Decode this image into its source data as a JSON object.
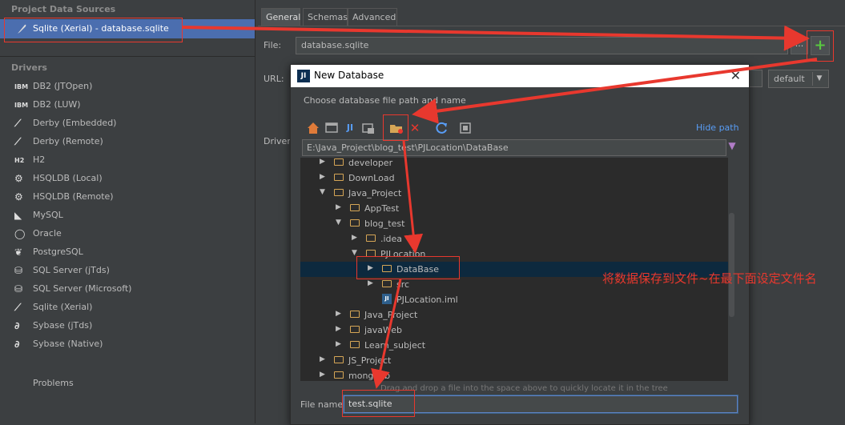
{
  "left": {
    "project_header": "Project Data Sources",
    "selected_source": "Sqlite (Xerial) - database.sqlite",
    "drivers_header": "Drivers",
    "drivers": [
      {
        "icon": "IBM",
        "label": "DB2 (JTOpen)"
      },
      {
        "icon": "IBM",
        "label": "DB2 (LUW)"
      },
      {
        "icon": "feather",
        "label": "Derby (Embedded)"
      },
      {
        "icon": "feather",
        "label": "Derby (Remote)"
      },
      {
        "icon": "H2",
        "label": "H2"
      },
      {
        "icon": "gear",
        "label": "HSQLDB (Local)"
      },
      {
        "icon": "gear",
        "label": "HSQLDB (Remote)"
      },
      {
        "icon": "dolphin",
        "label": "MySQL"
      },
      {
        "icon": "circle",
        "label": "Oracle"
      },
      {
        "icon": "elephant",
        "label": "PostgreSQL"
      },
      {
        "icon": "server",
        "label": "SQL Server (jTds)"
      },
      {
        "icon": "server",
        "label": "SQL Server (Microsoft)"
      },
      {
        "icon": "feather",
        "label": "Sqlite (Xerial)"
      },
      {
        "icon": "swirl",
        "label": "Sybase (jTds)"
      },
      {
        "icon": "swirl",
        "label": "Sybase (Native)"
      }
    ],
    "problems": "Problems"
  },
  "tabs": [
    "General",
    "Schemas",
    "Advanced"
  ],
  "form": {
    "file_label": "File:",
    "file_value": "database.sqlite",
    "browse": "...",
    "add": "+",
    "url_label": "URL:",
    "url_mode": "default",
    "driver_label": "Driver"
  },
  "dialog": {
    "title": "New Database",
    "logo": "JI",
    "close": "✕",
    "subtitle": "Choose database file path and name",
    "hide_path": "Hide path",
    "path": "E:\\Java_Project\\blog_test\\PJLocation\\DataBase",
    "tree": [
      {
        "name": "developer",
        "depth": 0,
        "state": "collapsed",
        "type": "folder"
      },
      {
        "name": "DownLoad",
        "depth": 0,
        "state": "collapsed",
        "type": "folder"
      },
      {
        "name": "Java_Project",
        "depth": 0,
        "state": "expanded",
        "type": "folder"
      },
      {
        "name": "AppTest",
        "depth": 1,
        "state": "collapsed",
        "type": "folder"
      },
      {
        "name": "blog_test",
        "depth": 1,
        "state": "expanded",
        "type": "folder"
      },
      {
        "name": ".idea",
        "depth": 2,
        "state": "collapsed",
        "type": "folder"
      },
      {
        "name": "PJLocation",
        "depth": 2,
        "state": "expanded",
        "type": "folder"
      },
      {
        "name": "DataBase",
        "depth": 3,
        "state": "collapsed",
        "type": "folder",
        "selected": true
      },
      {
        "name": "src",
        "depth": 3,
        "state": "collapsed",
        "type": "folder"
      },
      {
        "name": "PJLocation.iml",
        "depth": 3,
        "state": "leaf",
        "type": "iml"
      },
      {
        "name": "Java_Project",
        "depth": 1,
        "state": "collapsed",
        "type": "folder"
      },
      {
        "name": "javaWeb",
        "depth": 1,
        "state": "collapsed",
        "type": "folder"
      },
      {
        "name": "Learn_subject",
        "depth": 1,
        "state": "collapsed",
        "type": "folder"
      },
      {
        "name": "JS_Project",
        "depth": 0,
        "state": "collapsed",
        "type": "folder"
      },
      {
        "name": "mongodb",
        "depth": 0,
        "state": "collapsed",
        "type": "folder"
      }
    ],
    "dnd_hint": "Drag and drop a file into the space above to quickly locate it in the tree",
    "filename_label": "File name:",
    "filename_value": "test.sqlite"
  },
  "annotation": {
    "text": "将数据保存到文件~在最下面设定文件名",
    "color": "#e8382e"
  },
  "colors": {
    "selection": "#4b6eaf",
    "tree_selection": "#0d293e",
    "link": "#589df6",
    "add_green": "#59c840"
  }
}
